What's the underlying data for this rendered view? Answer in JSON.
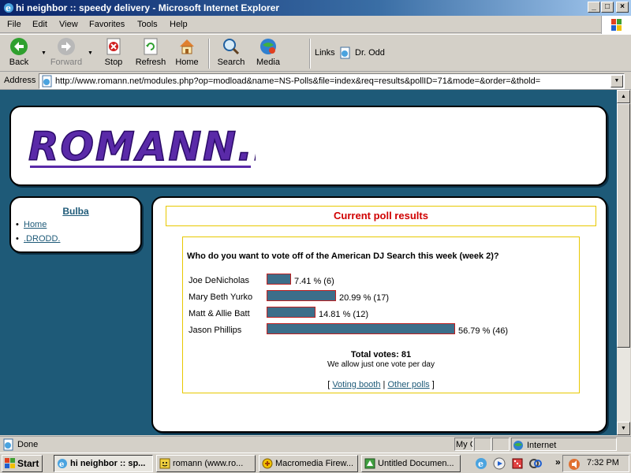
{
  "window": {
    "title": "hi neighbor :: speedy delivery - Microsoft Internet Explorer",
    "controls": {
      "minimize": "_",
      "maximize": "□",
      "close": "×"
    }
  },
  "menu": [
    "File",
    "Edit",
    "View",
    "Favorites",
    "Tools",
    "Help"
  ],
  "toolbar": {
    "back": "Back",
    "forward": "Forward",
    "stop": "Stop",
    "refresh": "Refresh",
    "home": "Home",
    "search": "Search",
    "media": "Media",
    "links_label": "Links",
    "links_item": "Dr. Odd"
  },
  "address": {
    "label": "Address",
    "url": "http://www.romann.net/modules.php?op=modload&name=NS-Polls&file=index&req=results&pollID=71&mode=&order=&thold="
  },
  "site": {
    "logo_text": "ROMANN.NET",
    "nav": {
      "title": "Bulba",
      "items": [
        "Home",
        ".DRODD."
      ]
    }
  },
  "poll": {
    "header": "Current poll results",
    "question": "Who do you want to vote off of the American DJ Search this week (week 2)?",
    "options": [
      {
        "label": "Joe DeNicholas",
        "percent": 7.41,
        "percent_text": "7.41 % (6)",
        "votes": 6
      },
      {
        "label": "Mary Beth Yurko",
        "percent": 20.99,
        "percent_text": "20.99 % (17)",
        "votes": 17
      },
      {
        "label": "Matt & Allie Batt",
        "percent": 14.81,
        "percent_text": "14.81 % (12)",
        "votes": 12
      },
      {
        "label": "Jason Phillips",
        "percent": 56.79,
        "percent_text": "56.79 % (46)",
        "votes": 46
      }
    ],
    "total": "Total votes: 81",
    "note": "We allow just one vote per day",
    "links": {
      "open": "[",
      "voting_booth": "Voting booth",
      "sep": "|",
      "other_polls": "Other polls",
      "close": "]"
    }
  },
  "statusbar": {
    "text": "Done",
    "pane": "My C",
    "zone": "Internet"
  },
  "taskbar": {
    "start": "Start",
    "tasks": [
      {
        "label": "hi neighbor :: sp..."
      },
      {
        "label": "romann (www.ro..."
      },
      {
        "label": "Macromedia Firew..."
      },
      {
        "label": "Untitled Documen..."
      }
    ],
    "chevron": "»",
    "clock": "7:32 PM"
  },
  "colors": {
    "page_bg": "#1e5a78",
    "bar_fill": "#3c6e8a",
    "bar_border": "#c02020",
    "poll_header_text": "#d00000",
    "frame_gold": "#e8c800"
  }
}
